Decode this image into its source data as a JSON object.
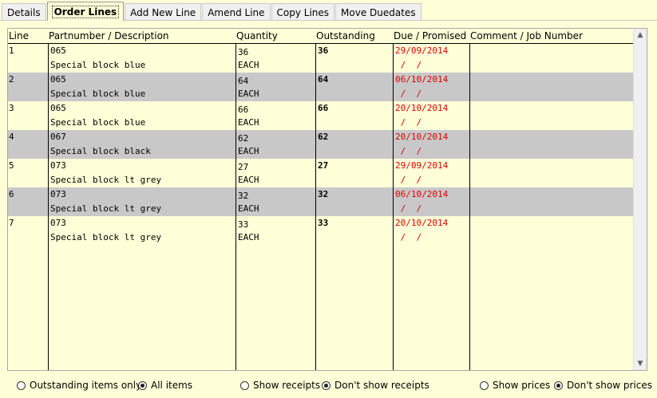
{
  "tabs": [
    {
      "label": "Details",
      "active": false
    },
    {
      "label": "Order Lines",
      "active": true
    },
    {
      "label": "Add New Line",
      "active": false
    },
    {
      "label": "Amend Line",
      "active": false
    },
    {
      "label": "Copy Lines",
      "active": false
    },
    {
      "label": "Move Duedates",
      "active": false
    }
  ],
  "grid": {
    "columns": [
      "Line",
      "Partnumber / Description",
      "Quantity",
      "Outstanding",
      "Due / Promised",
      "Comment / Job Number"
    ],
    "rows": [
      {
        "line": "1",
        "part": "065",
        "desc": "Special block blue",
        "qty": "36",
        "unit": "EACH",
        "outstanding": "36",
        "due": "29/09/2014",
        "promised": " /  /",
        "comment": ""
      },
      {
        "line": "2",
        "part": "065",
        "desc": "Special block blue",
        "qty": "64",
        "unit": "EACH",
        "outstanding": "64",
        "due": "06/10/2014",
        "promised": " /  /",
        "comment": ""
      },
      {
        "line": "3",
        "part": "065",
        "desc": "Special block blue",
        "qty": "66",
        "unit": "EACH",
        "outstanding": "66",
        "due": "20/10/2014",
        "promised": " /  /",
        "comment": ""
      },
      {
        "line": "4",
        "part": "067",
        "desc": "Special block black",
        "qty": "62",
        "unit": "EACH",
        "outstanding": "62",
        "due": "20/10/2014",
        "promised": " /  /",
        "comment": ""
      },
      {
        "line": "5",
        "part": "073",
        "desc": "Special block lt grey",
        "qty": "27",
        "unit": "EACH",
        "outstanding": "27",
        "due": "29/09/2014",
        "promised": " /  /",
        "comment": ""
      },
      {
        "line": "6",
        "part": "073",
        "desc": "Special block lt grey",
        "qty": "32",
        "unit": "EACH",
        "outstanding": "32",
        "due": "06/10/2014",
        "promised": " /  /",
        "comment": ""
      },
      {
        "line": "7",
        "part": "073",
        "desc": "Special block lt grey",
        "qty": "33",
        "unit": "EACH",
        "outstanding": "33",
        "due": "20/10/2014",
        "promised": " /  /",
        "comment": ""
      }
    ]
  },
  "options": {
    "outstanding_only": {
      "label": "Outstanding items only",
      "checked": false
    },
    "all_items": {
      "label": "All items",
      "checked": true
    },
    "show_receipts": {
      "label": "Show receipts",
      "checked": false
    },
    "dont_show_receipts": {
      "label": "Don't show receipts",
      "checked": true
    },
    "show_prices": {
      "label": "Show prices",
      "checked": false
    },
    "dont_show_prices": {
      "label": "Don't show prices",
      "checked": true
    }
  },
  "colors": {
    "background": "#ffffd8",
    "alt_row": "#c8c8c8",
    "due_text": "#e00000"
  }
}
